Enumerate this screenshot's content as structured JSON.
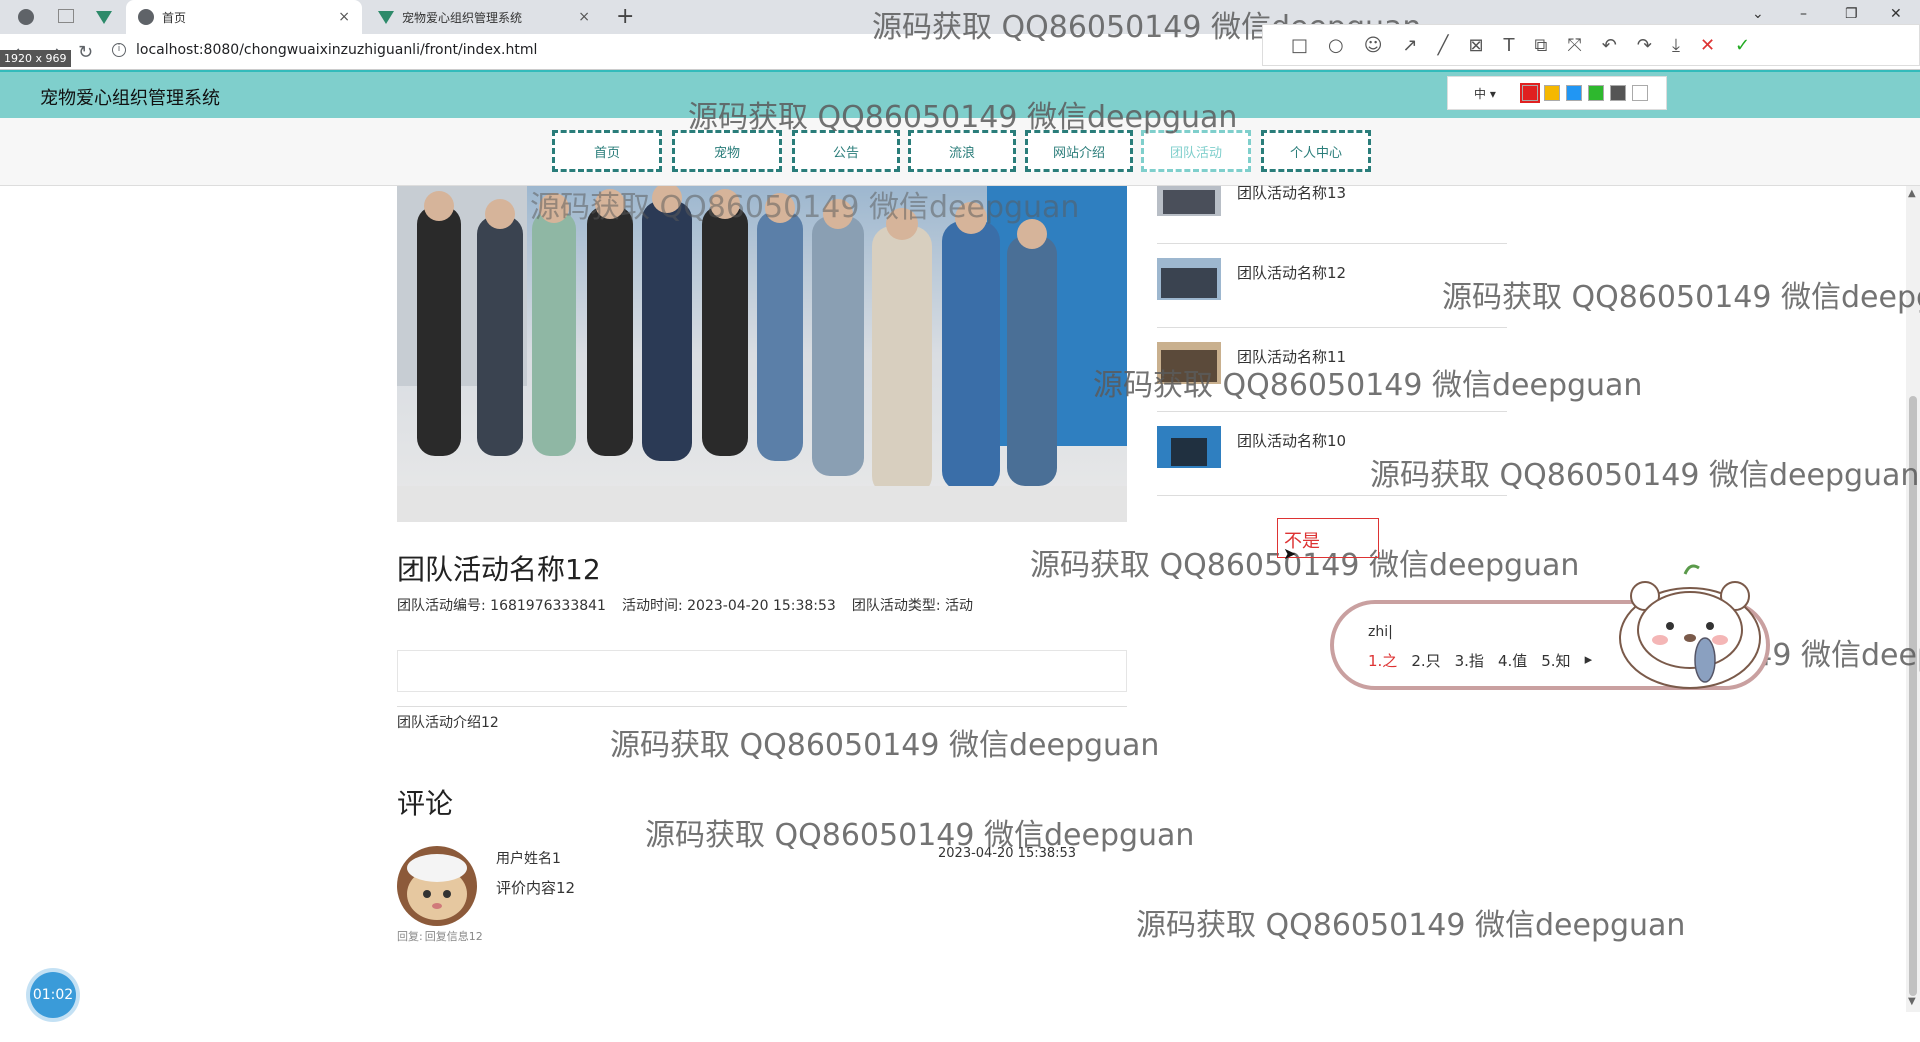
{
  "browser": {
    "tabs": [
      {
        "label": "首页",
        "active": true
      },
      {
        "label": "宠物爱心组织管理系统",
        "active": false
      }
    ],
    "new_tab": "+",
    "url": "localhost:8080/chongwuaixinzuzhiguanli/front/index.html",
    "dims_label": "1920 x 969",
    "window_controls": [
      "⌄",
      "–",
      "❐",
      "✕"
    ]
  },
  "site": {
    "title": "宠物爱心组织管理系统",
    "nav": [
      {
        "label": "首页",
        "active": false
      },
      {
        "label": "宠物",
        "active": false
      },
      {
        "label": "公告",
        "active": false
      },
      {
        "label": "流浪",
        "active": false
      },
      {
        "label": "网站介绍",
        "active": false
      },
      {
        "label": "团队活动",
        "active": true
      },
      {
        "label": "个人中心",
        "active": false
      }
    ]
  },
  "detail": {
    "title": "团队活动名称12",
    "meta": [
      {
        "label": "团队活动编号:",
        "value": "1681976333841"
      },
      {
        "label": "活动时间:",
        "value": "2023-04-20 15:38:53"
      },
      {
        "label": "团队活动类型:",
        "value": "活动"
      }
    ],
    "intro": "团队活动介绍12"
  },
  "comments": {
    "heading": "评论",
    "items": [
      {
        "user": "用户姓名1",
        "content": "评价内容12",
        "time": "2023-04-20 15:38:53",
        "reply_label": "回复:",
        "reply": "回复信息12"
      }
    ]
  },
  "sidebar": {
    "items": [
      {
        "label": "团队活动名称13"
      },
      {
        "label": "团队活动名称12"
      },
      {
        "label": "团队活动名称11"
      },
      {
        "label": "团队活动名称10"
      }
    ]
  },
  "watermark": {
    "text": "源码获取 QQ86050149 微信deepguan",
    "partial_a": "源码获取 QQ86050149 微信deepg",
    "partial_b": "源码获取 QQ86050149 微信deep"
  },
  "snip_tool": {
    "size_label": "中 ▾",
    "colors": [
      "#e02020",
      "#f5b800",
      "#2196f3",
      "#2eb82e",
      "#555555",
      "#ffffff"
    ],
    "tools": [
      "□",
      "○",
      "☺",
      "↗",
      "╱",
      "⊠",
      "T",
      "⧉",
      "⤧",
      "↶",
      "↷",
      "⤓",
      "✕",
      "✓"
    ],
    "annotation_text": "不是"
  },
  "ime": {
    "input": "zhi|",
    "candidates": [
      "1.之",
      "2.只",
      "3.指",
      "4.值",
      "5.知"
    ],
    "next": "▸"
  },
  "timer": "01:02"
}
